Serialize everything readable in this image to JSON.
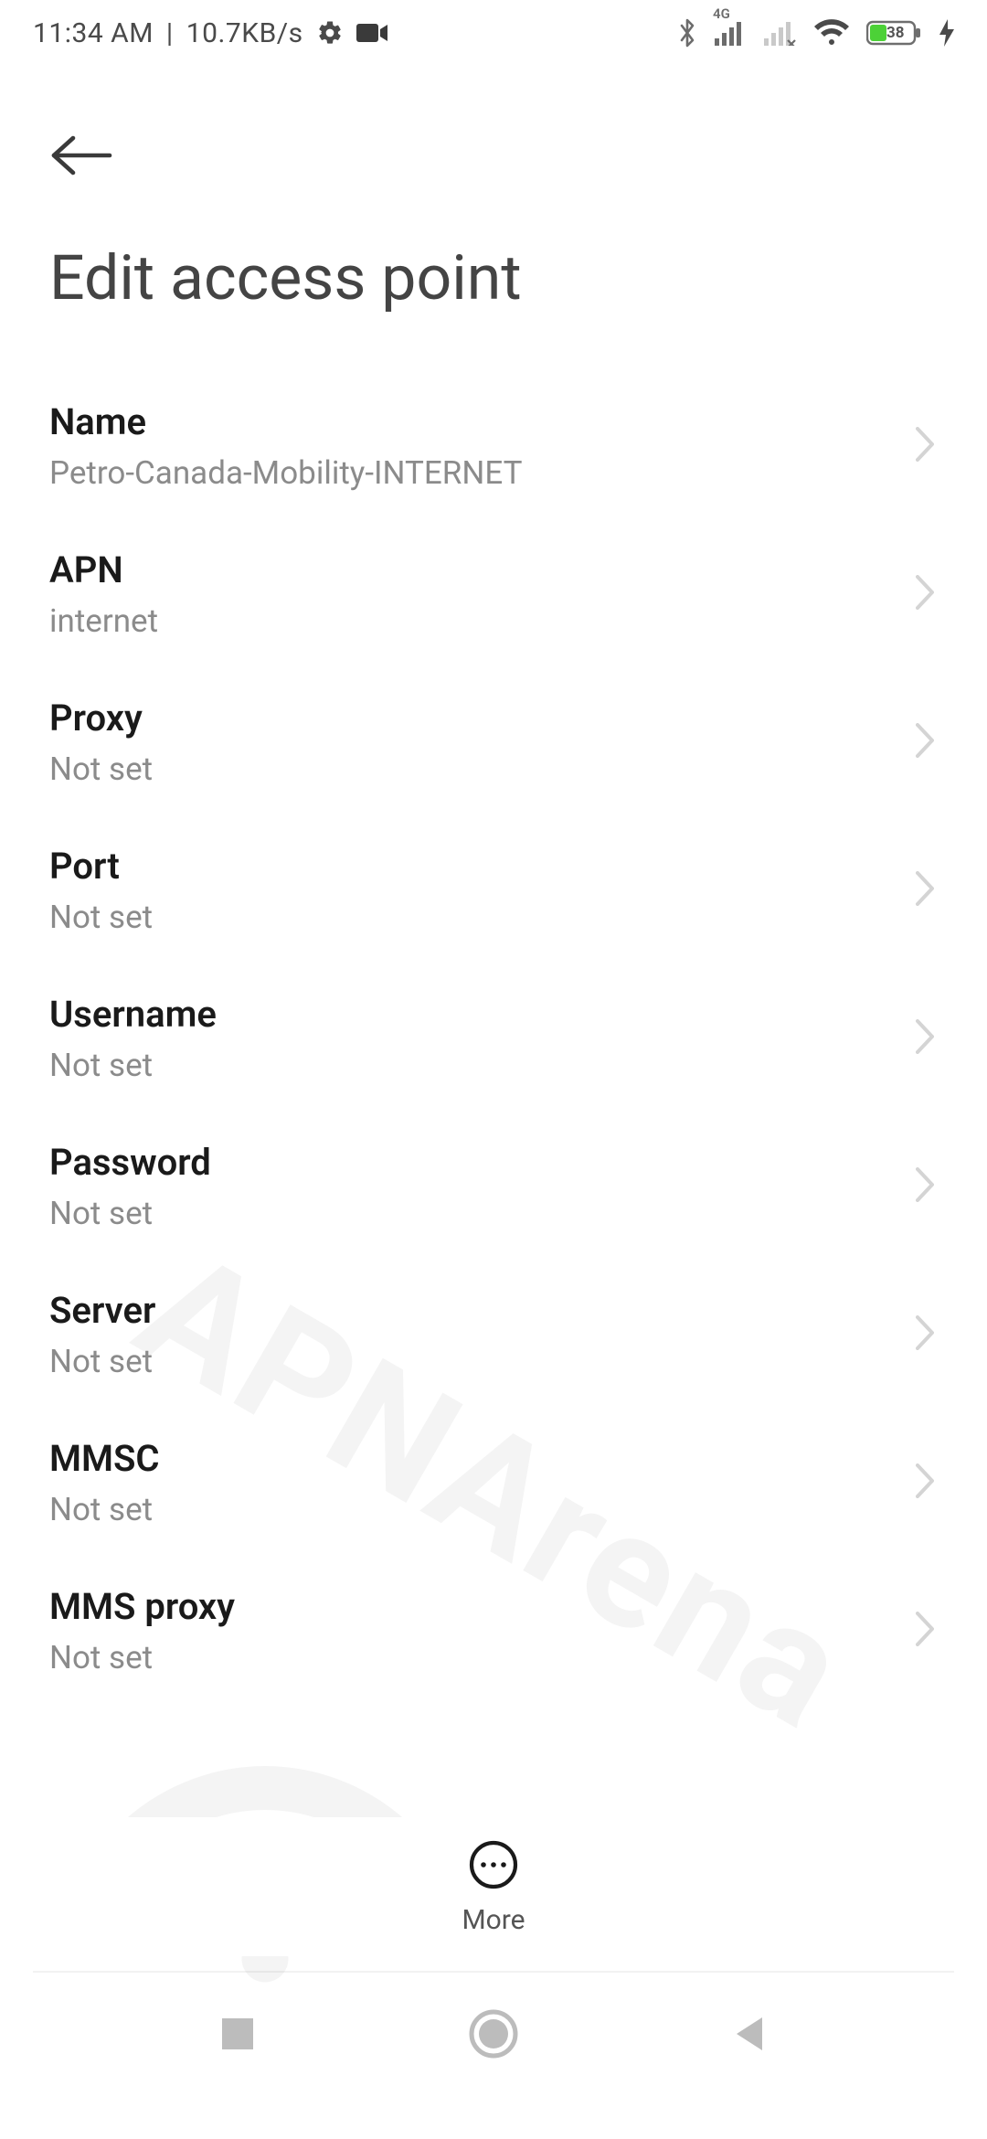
{
  "status": {
    "time": "11:34 AM",
    "separator": "|",
    "data_rate": "10.7KB/s",
    "net_label": "4G",
    "battery_pct": "38"
  },
  "header": {
    "title": "Edit access point"
  },
  "items": [
    {
      "label": "Name",
      "value": "Petro-Canada-Mobility-INTERNET"
    },
    {
      "label": "APN",
      "value": "internet"
    },
    {
      "label": "Proxy",
      "value": "Not set"
    },
    {
      "label": "Port",
      "value": "Not set"
    },
    {
      "label": "Username",
      "value": "Not set"
    },
    {
      "label": "Password",
      "value": "Not set"
    },
    {
      "label": "Server",
      "value": "Not set"
    },
    {
      "label": "MMSC",
      "value": "Not set"
    },
    {
      "label": "MMS proxy",
      "value": "Not set"
    }
  ],
  "bottom": {
    "more_label": "More"
  },
  "watermark": {
    "text": "APNArena"
  }
}
